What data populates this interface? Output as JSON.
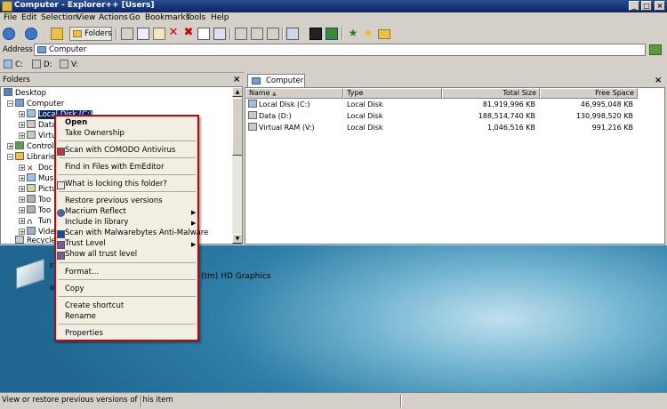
{
  "window": {
    "title": "Computer - Explorer++ [Users]"
  },
  "menu": [
    "File",
    "Edit",
    "Selection",
    "View",
    "Actions",
    "Go",
    "Bookmarks",
    "Tools",
    "Help"
  ],
  "toolbar": {
    "folders_label": "Folders"
  },
  "address": {
    "label": "Address",
    "value": "Computer"
  },
  "drives": [
    "C:",
    "D:",
    "V:"
  ],
  "folders_pane": {
    "title": "Folders",
    "close": "×"
  },
  "tree": [
    {
      "label": "Desktop"
    },
    {
      "label": "Computer"
    },
    {
      "label": "Local Disk (C:)"
    },
    {
      "label": "Data"
    },
    {
      "label": "Virtu"
    },
    {
      "label": "Control"
    },
    {
      "label": "Libraries"
    },
    {
      "label": "Doc"
    },
    {
      "label": "Mus"
    },
    {
      "label": "Pictu"
    },
    {
      "label": "Too"
    },
    {
      "label": "Too"
    },
    {
      "label": "Tun"
    },
    {
      "label": "Vide"
    },
    {
      "label": "Recycle"
    }
  ],
  "tab": {
    "label": "Computer",
    "close": "×"
  },
  "columns": [
    "Name",
    "Type",
    "Total Size",
    "Free Space"
  ],
  "rows": [
    {
      "name": "Local Disk (C:)",
      "type": "Local Disk",
      "total": "81,919,996 KB",
      "free": "46,995,048 KB"
    },
    {
      "name": "Data (D:)",
      "type": "Local Disk",
      "total": "188,514,740 KB",
      "free": "130,998,520 KB"
    },
    {
      "name": "Virtual RAM (V:)",
      "type": "Local Disk",
      "total": "1,046,516 KB",
      "free": "991,216 KB"
    }
  ],
  "desktop": {
    "graphics_text": "(tm) HD Graphics"
  },
  "context_menu": [
    {
      "label": "Open",
      "bold": true
    },
    {
      "label": "Take Ownership"
    },
    {
      "label": "Scan with COMODO Antivirus"
    },
    {
      "label": "Find in Files with EmEditor"
    },
    {
      "label": "What is locking this folder?"
    },
    {
      "label": "Restore previous versions"
    },
    {
      "label": "Macrium Reflect",
      "submenu": true
    },
    {
      "label": "Include in library",
      "submenu": true
    },
    {
      "label": "Scan with Malwarebytes Anti-Malware"
    },
    {
      "label": "Trust Level",
      "submenu": true
    },
    {
      "label": "Show all trust level"
    },
    {
      "label": "Format..."
    },
    {
      "label": "Copy"
    },
    {
      "label": "Create shortcut"
    },
    {
      "label": "Rename"
    },
    {
      "label": "Properties"
    }
  ],
  "status": {
    "text": "View or restore previous versions of this item"
  },
  "colors": {
    "title_bar": "#0a246a",
    "selection": "#0a246a",
    "menu_highlight_border": "#cc0000"
  }
}
